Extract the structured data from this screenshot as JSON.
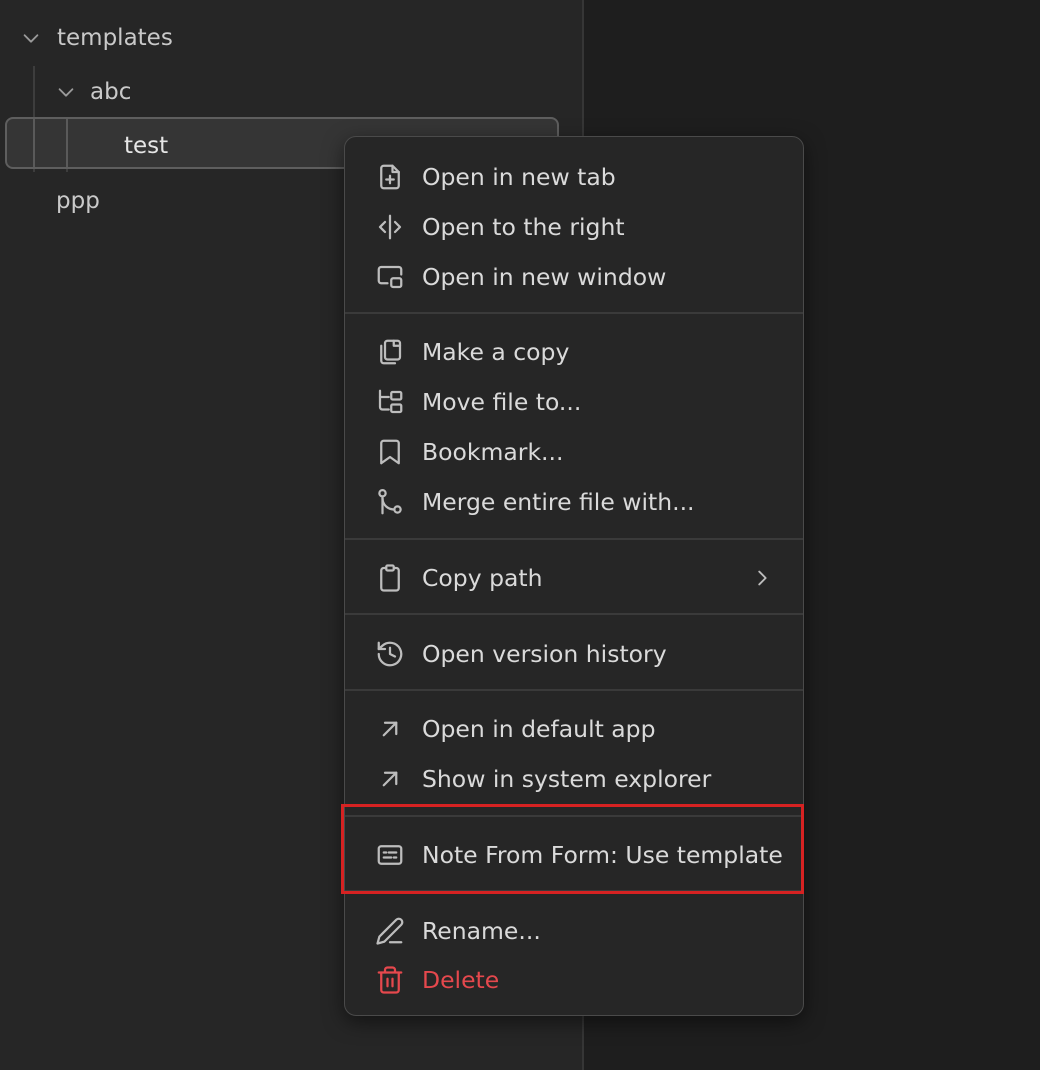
{
  "file_tree": {
    "items": [
      {
        "label": "templates",
        "expanded": true
      },
      {
        "label": "abc",
        "expanded": true
      },
      {
        "label": "test",
        "selected": true
      },
      {
        "label": "ppp"
      }
    ]
  },
  "context_menu": {
    "groups": [
      [
        {
          "icon": "file-plus-icon",
          "label": "Open in new tab"
        },
        {
          "icon": "split-right-icon",
          "label": "Open to the right"
        },
        {
          "icon": "new-window-icon",
          "label": "Open in new window"
        }
      ],
      [
        {
          "icon": "copy-icon",
          "label": "Make a copy"
        },
        {
          "icon": "folder-tree-icon",
          "label": "Move file to..."
        },
        {
          "icon": "bookmark-icon",
          "label": "Bookmark..."
        },
        {
          "icon": "git-merge-icon",
          "label": "Merge entire file with..."
        }
      ],
      [
        {
          "icon": "clipboard-icon",
          "label": "Copy path",
          "has_submenu": true
        }
      ],
      [
        {
          "icon": "history-icon",
          "label": "Open version history"
        }
      ],
      [
        {
          "icon": "arrow-up-right-icon",
          "label": "Open in default app"
        },
        {
          "icon": "arrow-up-right-icon",
          "label": "Show in system explorer"
        }
      ],
      [
        {
          "icon": "form-icon",
          "label": "Note From Form: Use template",
          "highlighted": true
        }
      ],
      [
        {
          "icon": "pencil-icon",
          "label": "Rename..."
        },
        {
          "icon": "trash-icon",
          "label": "Delete",
          "danger": true
        }
      ]
    ]
  },
  "colors": {
    "danger": "#e5484d",
    "highlight_box": "#d62222",
    "menu_bg": "#262626",
    "sidebar_bg": "#262626"
  }
}
